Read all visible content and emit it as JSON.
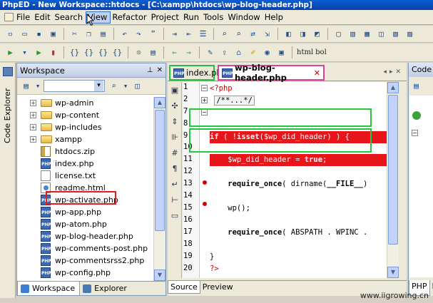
{
  "window": {
    "title": "PhpED - New Workspace::htdocs - [C:\\xampp\\htdocs\\wp-blog-header.php]"
  },
  "menu": {
    "items": [
      "File",
      "Edit",
      "Search",
      "View",
      "Refactor",
      "Project",
      "Run",
      "Tools",
      "Window",
      "Help"
    ],
    "active": "View"
  },
  "toolbar2": {
    "text_buttons": [
      "html",
      "bol"
    ]
  },
  "left_strip": {
    "label": "Code Explorer"
  },
  "workspace": {
    "title": "Workspace",
    "tree": [
      {
        "label": "wp-admin",
        "type": "folder",
        "expandable": true
      },
      {
        "label": "wp-content",
        "type": "folder",
        "expandable": true
      },
      {
        "label": "wp-includes",
        "type": "folder",
        "expandable": true
      },
      {
        "label": "xampp",
        "type": "folder",
        "expandable": true
      },
      {
        "label": "htdocs.zip",
        "type": "zip",
        "expandable": false
      },
      {
        "label": "index.php",
        "type": "php",
        "expandable": false,
        "highlighted": true
      },
      {
        "label": "license.txt",
        "type": "txt",
        "expandable": false
      },
      {
        "label": "readme.html",
        "type": "html",
        "expandable": false
      },
      {
        "label": "wp-activate.php",
        "type": "php",
        "expandable": false
      },
      {
        "label": "wp-app.php",
        "type": "php",
        "expandable": false
      },
      {
        "label": "wp-atom.php",
        "type": "php",
        "expandable": false
      },
      {
        "label": "wp-blog-header.php",
        "type": "php",
        "expandable": false
      },
      {
        "label": "wp-comments-post.php",
        "type": "php",
        "expandable": false
      },
      {
        "label": "wp-commentsrss2.php",
        "type": "php",
        "expandable": false
      },
      {
        "label": "wp-config.php",
        "type": "php",
        "expandable": false
      }
    ],
    "bottom_tabs": [
      "Workspace",
      "Explorer"
    ]
  },
  "editor": {
    "tabs": [
      {
        "label": "index.php",
        "active": false
      },
      {
        "label": "wp-blog-header.php",
        "active": true
      }
    ],
    "gutter_numbers": [
      "1",
      "2",
      "7",
      "8",
      "9",
      "10",
      "11",
      "12",
      "13",
      "14",
      "15",
      "16",
      "17",
      "18",
      "19",
      "20"
    ],
    "code": {
      "l1": "<?php",
      "l2": "/**...*/",
      "l8a": "if",
      "l8b": " ( !",
      "l8c": "isset",
      "l8d": "($wp_did_header) ) {",
      "l10a": "    $wp_did_header = ",
      "l10b": "true",
      "l10c": ";",
      "l12a": "    require_once",
      "l12b": "( dirname(",
      "l12c": "__FILE__",
      "l12d": ")",
      "l14": "    wp();",
      "l16a": "    require_once",
      "l16b": "( ABSPATH . WPINC .",
      "l18": "}",
      "l20": "?>"
    },
    "bottom_tabs": [
      "Source",
      "Preview"
    ]
  },
  "right_panel": {
    "title": "Code M",
    "bottom_tabs": [
      "PHP",
      "H"
    ]
  },
  "watermark": "www.iigrowing.cn",
  "colors": {
    "title_bar": "#0a5fd6",
    "breakpoint_line": "#e8151a",
    "annotation_green": "#24c83e",
    "annotation_red": "#e01c1c",
    "annotation_pink": "#dd3fa5"
  }
}
